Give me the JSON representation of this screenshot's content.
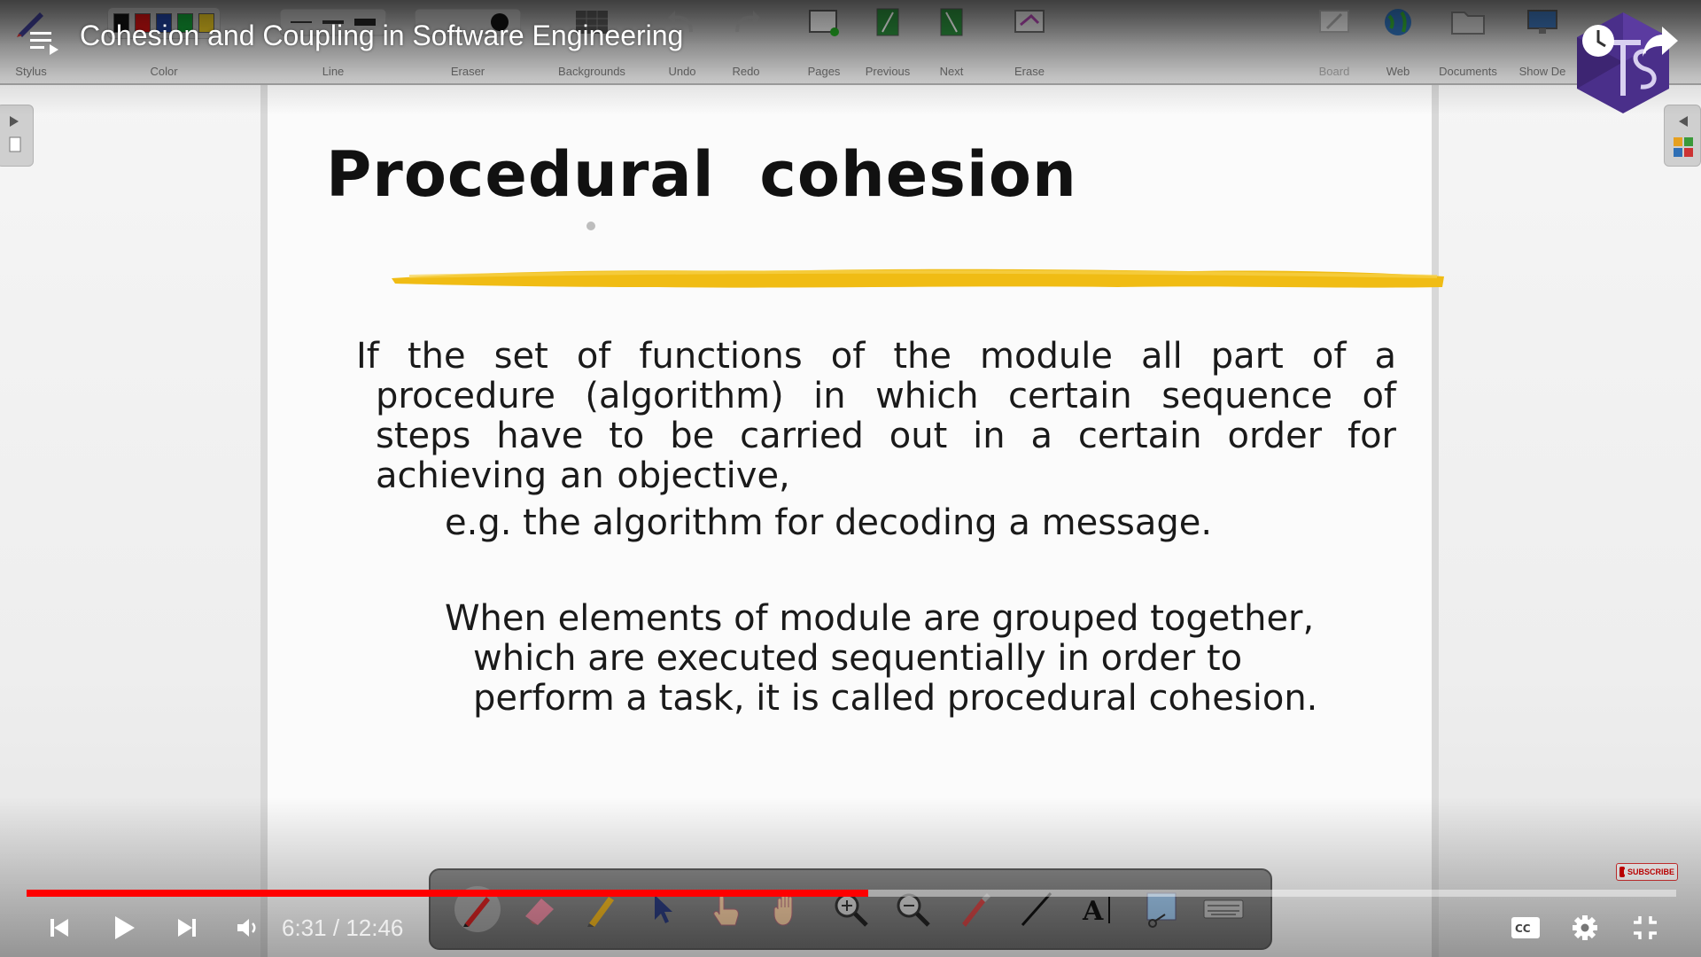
{
  "player": {
    "video_title": "Cohesion and Coupling in Software Engineering",
    "time_current": "6:31",
    "time_separator": "/",
    "time_total": "12:46",
    "progress_fraction": 0.51,
    "subscribe_label": "SUBSCRIBE",
    "accent_color": "#ff0000",
    "icons": [
      "playlist-icon",
      "watch-later-icon",
      "share-icon",
      "previous-icon",
      "play-icon",
      "next-icon",
      "volume-icon",
      "captions-icon",
      "settings-icon",
      "exit-fullscreen-icon"
    ]
  },
  "board_toolbar": {
    "labels": [
      "Stylus",
      "Color",
      "Line",
      "Eraser",
      "Backgrounds",
      "Undo",
      "Redo",
      "Pages",
      "Previous",
      "Next",
      "Erase",
      "Board",
      "Web",
      "Documents",
      "Show De"
    ],
    "swatch_colors": [
      "#111111",
      "#cc1111",
      "#1f3f99",
      "#119933",
      "#e0c020"
    ]
  },
  "slide": {
    "title": "Procedural  cohesion",
    "paragraph1": "If the set of functions of the module all part of a procedure (algorithm) in which certain sequence of steps have to be carried out in a certain order for achieving an objective,",
    "example": "e.g. the algorithm for decoding a message.",
    "paragraph2": "When elements of module are grouped together, which are executed sequentially in order to perform a task, it is called procedural cohesion.",
    "highlight_color": "#f2c018"
  },
  "pen_tray": {
    "tools": [
      "pen",
      "eraser",
      "highlighter",
      "select",
      "pointer-hand",
      "drag-hand",
      "zoom-in",
      "zoom-out",
      "magic-pen",
      "line",
      "text",
      "screen-capture",
      "keyboard"
    ],
    "text_tool_label": "A"
  }
}
